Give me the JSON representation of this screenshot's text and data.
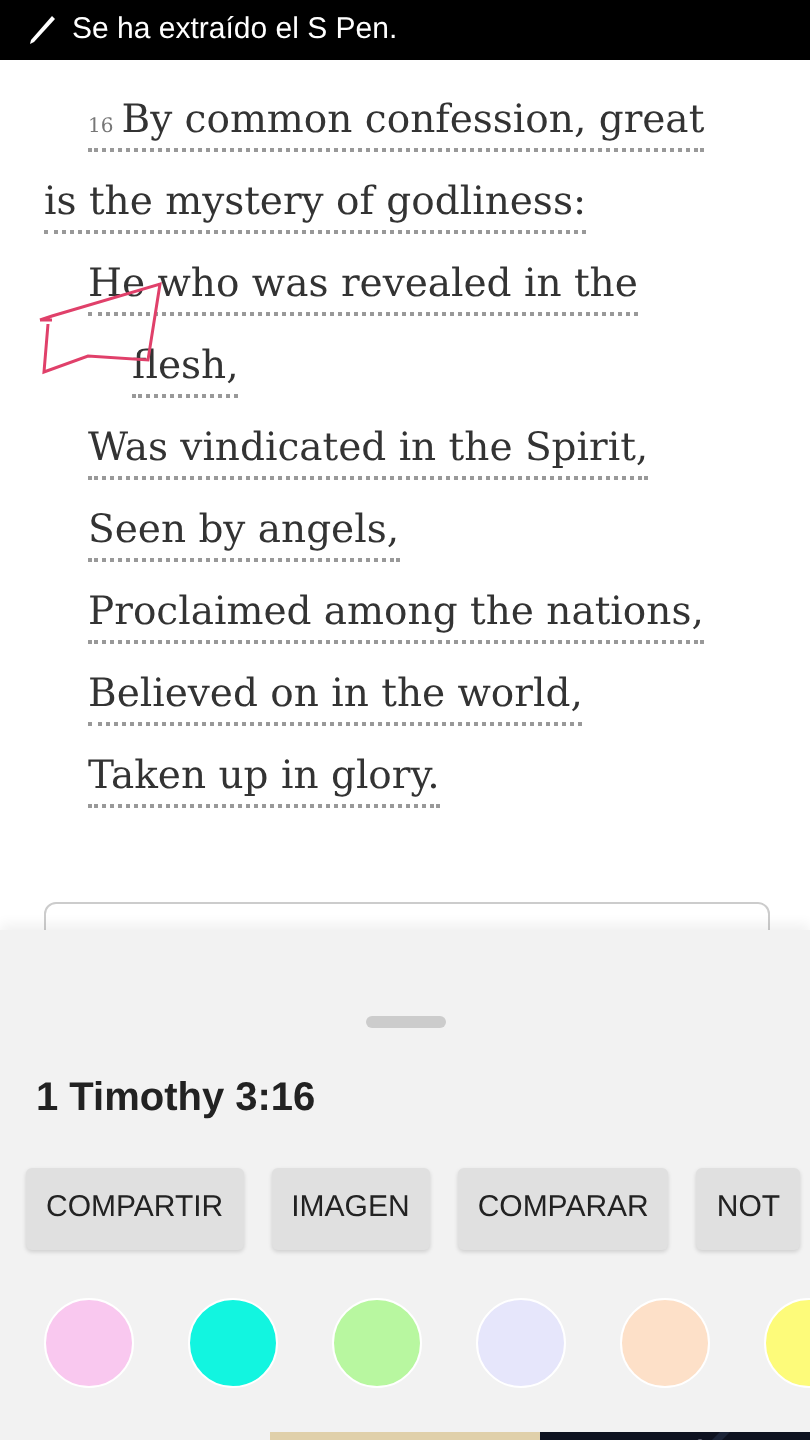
{
  "status_bar": {
    "text": "Se ha extraído el S Pen."
  },
  "verse": {
    "number": "16",
    "lines": [
      {
        "kind": "prose-first",
        "text": "By common confession, great"
      },
      {
        "kind": "prose",
        "text": "is the mystery of godliness:"
      },
      {
        "kind": "poetry",
        "text": "He who was revealed in the"
      },
      {
        "kind": "continuation",
        "text": "flesh,"
      },
      {
        "kind": "poetry",
        "text": "Was vindicated in the Spirit,"
      },
      {
        "kind": "poetry",
        "text": "Seen by angels,"
      },
      {
        "kind": "poetry",
        "text": "Proclaimed among the nations,"
      },
      {
        "kind": "poetry",
        "text": "Believed on in the world,"
      },
      {
        "kind": "poetry",
        "text": "Taken up in glory."
      }
    ]
  },
  "sheet": {
    "reference": "1 Timothy 3:16",
    "actions": [
      "COMPARTIR",
      "IMAGEN",
      "COMPARAR",
      "NOT"
    ],
    "highlight_colors": [
      {
        "color": "#f9c8ef"
      },
      {
        "color": "#12f5e0"
      },
      {
        "color": "#b8f7a0"
      },
      {
        "color": "#e6e6fb"
      },
      {
        "color": "#fde0c8"
      },
      {
        "color": "#fdfb7a"
      }
    ]
  }
}
